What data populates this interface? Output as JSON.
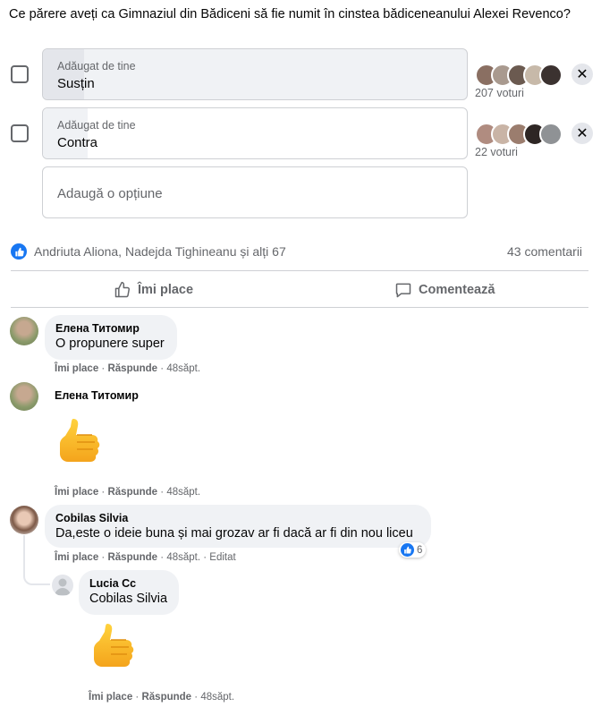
{
  "poll": {
    "question": "Ce părere aveți ca Gimnaziul din Bădiceni să fie numit în cinstea bădiceneanului Alexei Revenco?",
    "options": [
      {
        "added_by": "Adăugat de tine",
        "label": "Susțin",
        "votes": "207 voturi",
        "fill": 0.9
      },
      {
        "added_by": "Adăugat de tine",
        "label": "Contra",
        "votes": "22 voturi",
        "fill": 0.1
      }
    ],
    "add_option_placeholder": "Adaugă o opțiune"
  },
  "reactions": {
    "names": "Andriuta Aliona, Nadejda Tighineanu și alți 67",
    "comments_count": "43 comentarii"
  },
  "actions": {
    "like_label": "Îmi place",
    "comment_label": "Comentează"
  },
  "comments": [
    {
      "author": "Елена Титомир",
      "text": "O propunere super",
      "like": "Îmi place",
      "reply": "Răspunde",
      "time": "48săpt."
    },
    {
      "author": "Елена Титомир",
      "sticker": "thumbs-up",
      "like": "Îmi place",
      "reply": "Răspunde",
      "time": "48săpt."
    },
    {
      "author": "Cobilas Silvia",
      "text": "Da,este o ideie buna și mai grozav ar fi dacă ar fi din nou liceu",
      "like": "Îmi place",
      "reply": "Răspunde",
      "time": "48săpt.",
      "edited": "Editat",
      "reaction_count": "6",
      "reply_item": {
        "author": "Lucia Cc",
        "text": "Cobilas Silvia",
        "sticker": "thumbs-up",
        "like": "Îmi place",
        "reply": "Răspunde",
        "time": "48săpt."
      }
    }
  ],
  "colors": {
    "accent": "#1877f2",
    "bubble": "#f0f2f5",
    "muted": "#65676b"
  },
  "separator_dot": "·"
}
